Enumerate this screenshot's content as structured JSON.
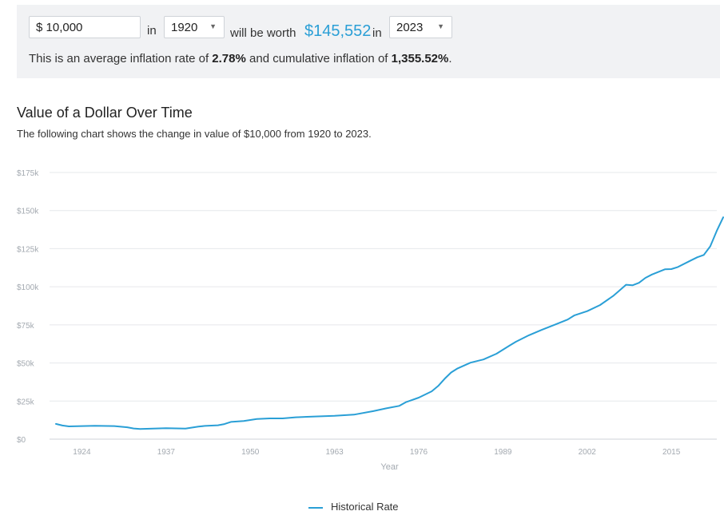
{
  "calculator": {
    "amount": "$ 10,000",
    "in_label": "in",
    "from_year": "1920",
    "worth_label": "will be worth",
    "worth_value": "$145,552",
    "in_label_2": "in",
    "to_year": "2023",
    "summary": {
      "prefix": "This is an average inflation rate of ",
      "avg_rate": "2.78%",
      "middle": " and cumulative inflation of ",
      "cumulative": "1,355.52%",
      "suffix": "."
    }
  },
  "colors": {
    "line": "#2a9fd6",
    "accent": "#2a9fd6",
    "panel": "#f1f2f4",
    "grid": "#e6e8eb",
    "tick": "#a3a9b0"
  },
  "chart_data": {
    "type": "line",
    "title": "Value of a Dollar Over Time",
    "subtitle": "The following chart shows the change in value of $10,000 from 1920 to 2023.",
    "xlabel": "Year",
    "ylabel": "",
    "xlim": [
      1920,
      2023
    ],
    "ylim": [
      0,
      175000
    ],
    "x_ticks": [
      1924,
      1937,
      1950,
      1963,
      1976,
      1989,
      2002,
      2015
    ],
    "y_ticks": [
      {
        "value": 0,
        "label": "$0"
      },
      {
        "value": 25000,
        "label": "$25k"
      },
      {
        "value": 50000,
        "label": "$50k"
      },
      {
        "value": 75000,
        "label": "$75k"
      },
      {
        "value": 100000,
        "label": "$100k"
      },
      {
        "value": 125000,
        "label": "$125k"
      },
      {
        "value": 150000,
        "label": "$150k"
      },
      {
        "value": 175000,
        "label": "$175k"
      }
    ],
    "grid": true,
    "legend_position": "bottom",
    "series": [
      {
        "name": "Historical Rate",
        "x": [
          1920,
          1921,
          1922,
          1924,
          1926,
          1929,
          1931,
          1932,
          1933,
          1937,
          1940,
          1942,
          1943,
          1945,
          1946,
          1947,
          1949,
          1951,
          1953,
          1955,
          1957,
          1960,
          1963,
          1966,
          1969,
          1971,
          1973,
          1974,
          1976,
          1978,
          1979,
          1980,
          1981,
          1982,
          1984,
          1986,
          1988,
          1990,
          1991,
          1993,
          1995,
          1997,
          1999,
          2000,
          2002,
          2004,
          2006,
          2007,
          2008,
          2009,
          2010,
          2011,
          2012,
          2014,
          2015,
          2016,
          2018,
          2019,
          2020,
          2021,
          2022,
          2023
        ],
        "values": [
          10000,
          8950,
          8380,
          8590,
          8760,
          8580,
          7830,
          7030,
          6670,
          7180,
          6980,
          8210,
          8720,
          9120,
          9890,
          11310,
          11880,
          13180,
          13600,
          13630,
          14350,
          14870,
          15290,
          16060,
          18380,
          20200,
          21830,
          24240,
          27270,
          31370,
          34920,
          39630,
          43730,
          46410,
          50180,
          52300,
          56040,
          61340,
          63930,
          68170,
          71720,
          75060,
          78510,
          81150,
          83970,
          88020,
          93970,
          97570,
          101320,
          100960,
          102610,
          105850,
          108040,
          111450,
          111580,
          112990,
          117250,
          119370,
          120850,
          126520,
          136640,
          145552
        ]
      }
    ]
  }
}
